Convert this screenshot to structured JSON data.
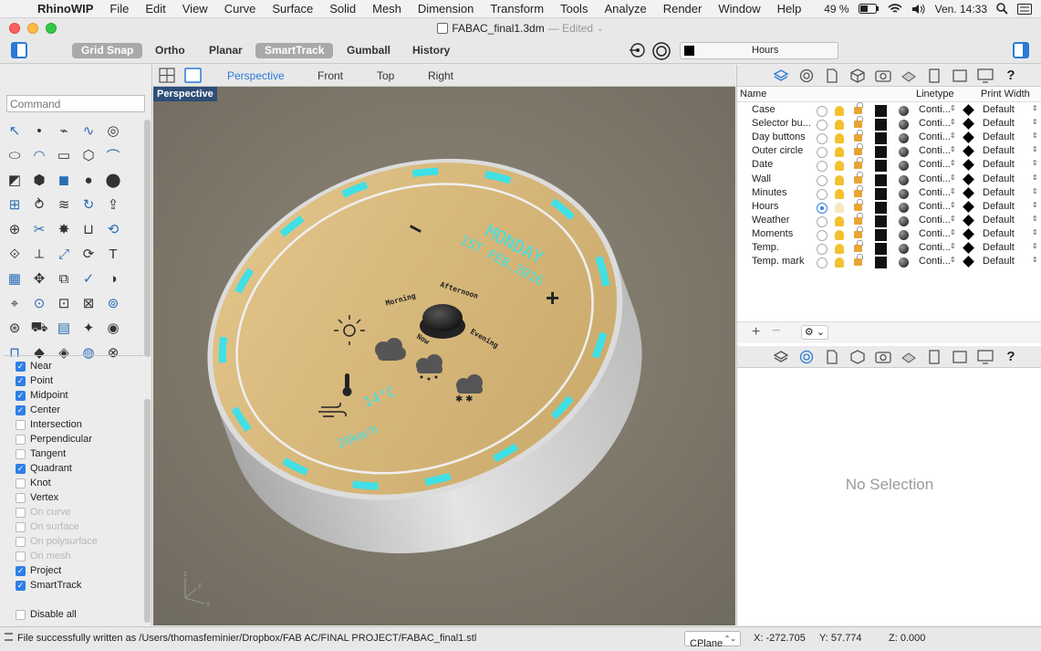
{
  "menubar": {
    "app": "RhinoWIP",
    "items": [
      "File",
      "Edit",
      "View",
      "Curve",
      "Surface",
      "Solid",
      "Mesh",
      "Dimension",
      "Transform",
      "Tools",
      "Analyze",
      "Render",
      "Window",
      "Help"
    ],
    "battery": "49 %",
    "clock": "Ven. 14:33"
  },
  "window": {
    "filename": "FABAC_final1.3dm",
    "status": "— Edited"
  },
  "toolbar": {
    "grid_snap": "Grid Snap",
    "ortho": "Ortho",
    "planar": "Planar",
    "smarttrack": "SmartTrack",
    "gumball": "Gumball",
    "history": "History",
    "layer_name": "Hours"
  },
  "command": {
    "placeholder": "Command"
  },
  "viewport_tabs": [
    "Perspective",
    "Front",
    "Top",
    "Right"
  ],
  "viewport": {
    "label": "Perspective",
    "clock_day": "MONDAY",
    "clock_date": "1ST FEB.2016",
    "minus": "−",
    "plus": "+",
    "morning": "Morning",
    "afternoon": "Afternoon",
    "now": "Now",
    "evening": "Evening",
    "temperature": "14°C",
    "wind": "20km/h",
    "axis_x": "x",
    "axis_y": "y",
    "axis_z": "z"
  },
  "osnaps": [
    {
      "label": "Near",
      "checked": true,
      "enabled": true
    },
    {
      "label": "Point",
      "checked": true,
      "enabled": true
    },
    {
      "label": "Midpoint",
      "checked": true,
      "enabled": true
    },
    {
      "label": "Center",
      "checked": true,
      "enabled": true
    },
    {
      "label": "Intersection",
      "checked": false,
      "enabled": true
    },
    {
      "label": "Perpendicular",
      "checked": false,
      "enabled": true
    },
    {
      "label": "Tangent",
      "checked": false,
      "enabled": true
    },
    {
      "label": "Quadrant",
      "checked": true,
      "enabled": true
    },
    {
      "label": "Knot",
      "checked": false,
      "enabled": true
    },
    {
      "label": "Vertex",
      "checked": false,
      "enabled": true
    },
    {
      "label": "On curve",
      "checked": false,
      "enabled": false
    },
    {
      "label": "On surface",
      "checked": false,
      "enabled": false
    },
    {
      "label": "On polysurface",
      "checked": false,
      "enabled": false
    },
    {
      "label": "On mesh",
      "checked": false,
      "enabled": false
    },
    {
      "label": "Project",
      "checked": true,
      "enabled": true
    },
    {
      "label": "SmartTrack",
      "checked": true,
      "enabled": true
    }
  ],
  "disable_all": "Disable all",
  "layers": {
    "col_name": "Name",
    "col_linetype": "Linetype",
    "col_printwidth": "Print Width",
    "rows": [
      {
        "name": "Case",
        "linetype": "Conti...",
        "printwidth": "Default",
        "current": false
      },
      {
        "name": "Selector bu...",
        "linetype": "Conti...",
        "printwidth": "Default",
        "current": false
      },
      {
        "name": "Day buttons",
        "linetype": "Conti...",
        "printwidth": "Default",
        "current": false
      },
      {
        "name": "Outer circle",
        "linetype": "Conti...",
        "printwidth": "Default",
        "current": false
      },
      {
        "name": "Date",
        "linetype": "Conti...",
        "printwidth": "Default",
        "current": false
      },
      {
        "name": "Wall",
        "linetype": "Conti...",
        "printwidth": "Default",
        "current": false
      },
      {
        "name": "Minutes",
        "linetype": "Conti...",
        "printwidth": "Default",
        "current": false
      },
      {
        "name": "Hours",
        "linetype": "Conti...",
        "printwidth": "Default",
        "current": true
      },
      {
        "name": "Weather",
        "linetype": "Conti...",
        "printwidth": "Default",
        "current": false
      },
      {
        "name": "Moments",
        "linetype": "Conti...",
        "printwidth": "Default",
        "current": false
      },
      {
        "name": "Temp.",
        "linetype": "Conti...",
        "printwidth": "Default",
        "current": false
      },
      {
        "name": "Temp. mark",
        "linetype": "Conti...",
        "printwidth": "Default",
        "current": false
      }
    ]
  },
  "properties": {
    "empty": "No Selection"
  },
  "status": {
    "message": "File successfully written as /Users/thomasfeminier/Dropbox/FAB AC/FINAL PROJECT/FABAC_final1.stl",
    "cplane": "CPlane",
    "x": "X: -272.705",
    "y": "Y: 57.774",
    "z": "Z: 0.000"
  },
  "colors": {
    "accent": "#2a7ad8",
    "led": "#3fe0e6",
    "wood": "#d9bb7e",
    "ground": "#7d776a"
  }
}
